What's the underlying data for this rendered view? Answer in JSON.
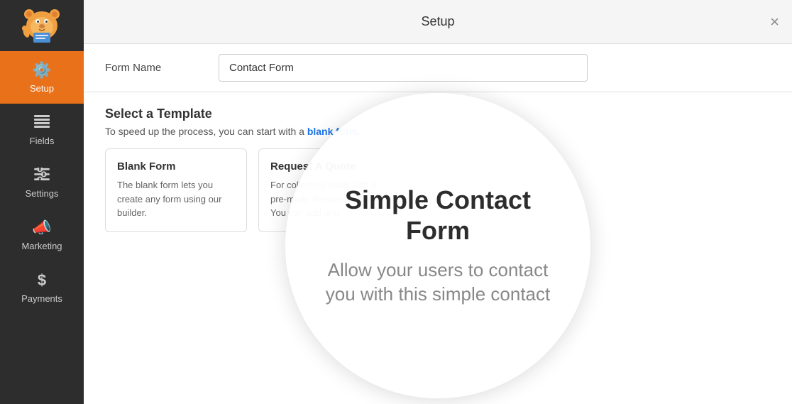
{
  "sidebar": {
    "items": [
      {
        "id": "setup",
        "label": "Setup",
        "icon": "⚙",
        "active": true
      },
      {
        "id": "fields",
        "label": "Fields",
        "icon": "☰",
        "active": false
      },
      {
        "id": "settings",
        "label": "Settings",
        "icon": "⧉",
        "active": false
      },
      {
        "id": "marketing",
        "label": "Marketing",
        "icon": "📣",
        "active": false
      },
      {
        "id": "payments",
        "label": "Payments",
        "icon": "$",
        "active": false
      }
    ]
  },
  "topbar": {
    "title": "Setup",
    "close_label": "×"
  },
  "form": {
    "name_label": "Form Name",
    "name_value": "Contact Form",
    "name_placeholder": "Contact Form"
  },
  "template_section": {
    "title": "Select a Template",
    "desc_prefix": "To speed up the process, you can start with a ",
    "desc_link": "blank form.",
    "cards": [
      {
        "id": "blank",
        "title": "Blank Form",
        "desc": "The blank form lets you create any form using our builder."
      },
      {
        "id": "request-quote",
        "title": "Request A Quote",
        "desc": "For collecting leads with a pre-made Request a form. You can add and"
      }
    ]
  },
  "tooltip": {
    "title": "Simple Contact Form",
    "body": "Allow your users to contact you with this simple contact"
  }
}
